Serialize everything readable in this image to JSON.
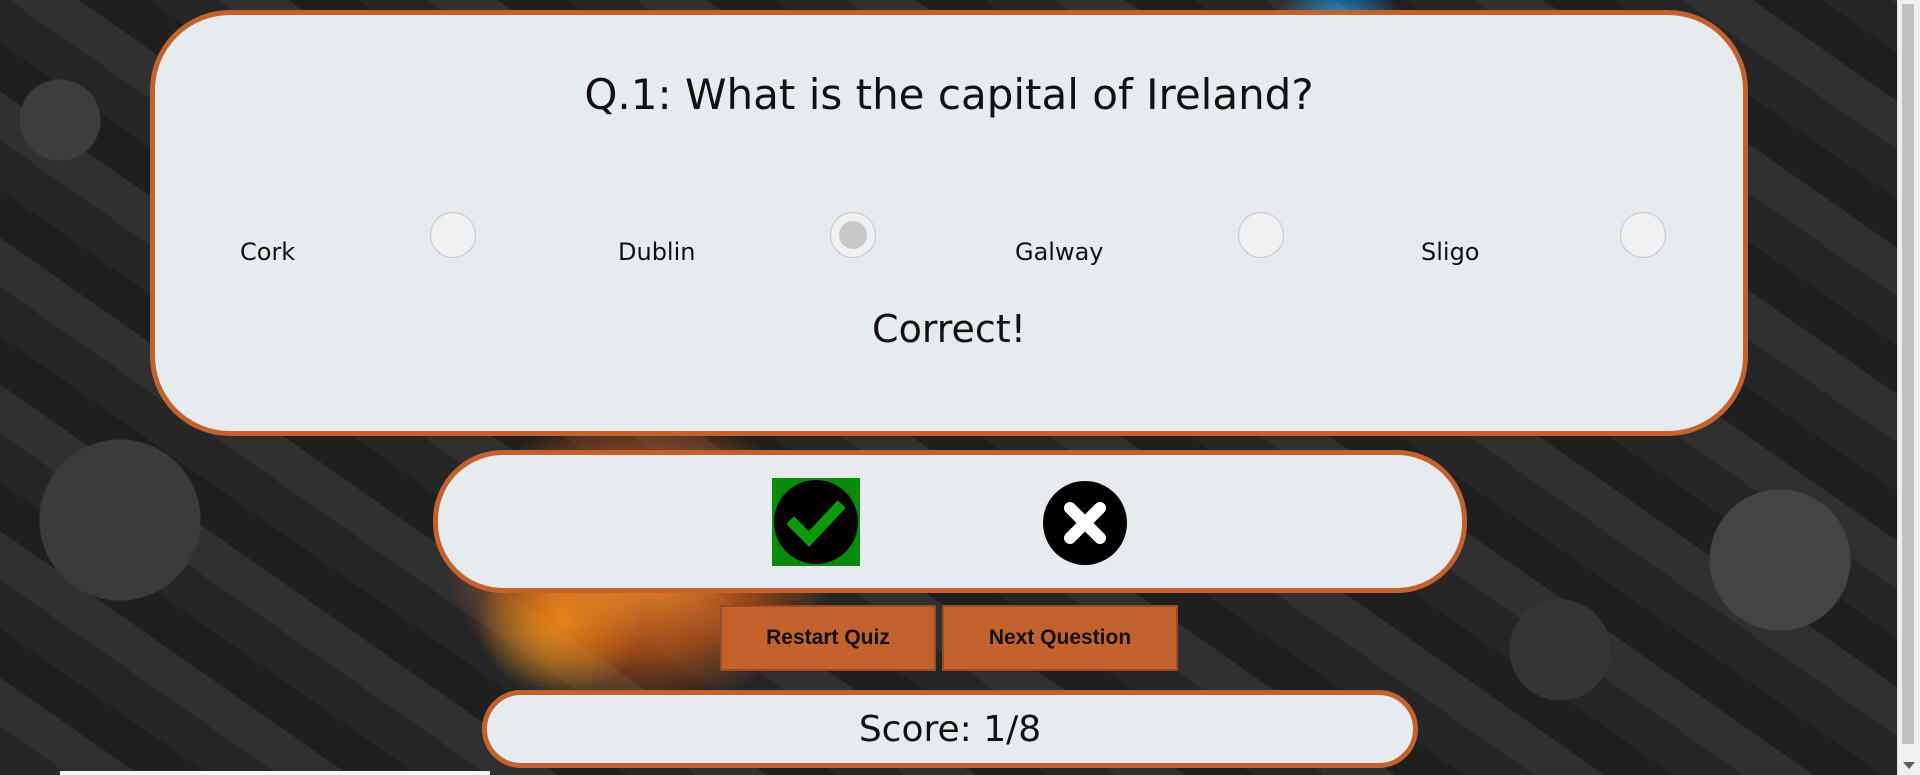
{
  "quiz": {
    "question": "Q.1: What is the capital of Ireland?",
    "answers": [
      {
        "label": "Cork",
        "selected": false
      },
      {
        "label": "Dublin",
        "selected": true
      },
      {
        "label": "Galway",
        "selected": false
      },
      {
        "label": "Sligo",
        "selected": false
      }
    ],
    "result": "Correct!"
  },
  "feedback": {
    "correct_icon": "checkmark-icon",
    "wrong_icon": "cross-icon",
    "correct_color": "#0a8a0a"
  },
  "controls": {
    "restart_label": "Restart Quiz",
    "next_label": "Next Question"
  },
  "score": {
    "text": "Score: 1/8"
  },
  "theme": {
    "accent": "#c4622d",
    "panel_bg": "#e6ebee"
  }
}
